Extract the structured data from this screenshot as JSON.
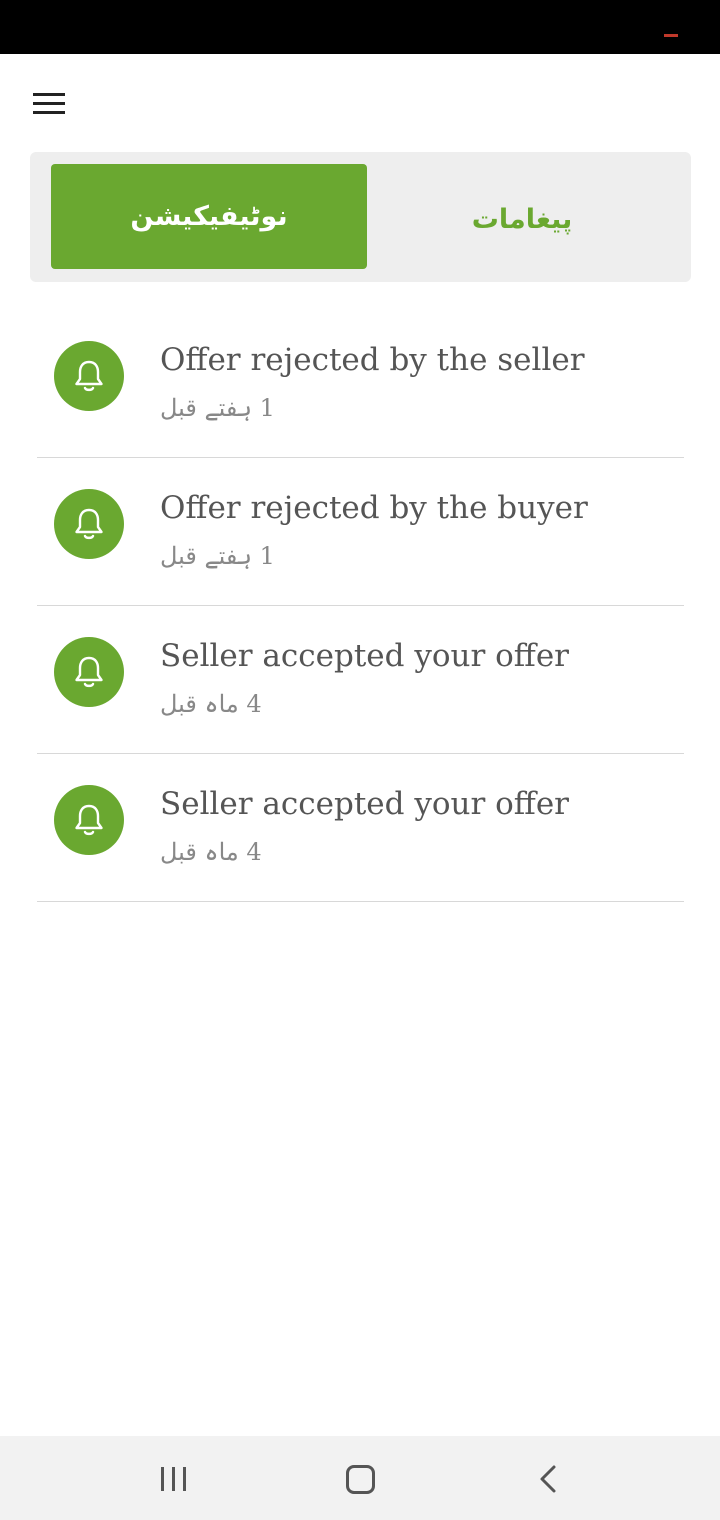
{
  "header": {
    "menu_icon": "hamburger-menu-icon"
  },
  "tabs": {
    "notifications_label": "نوٹیفیکیشن",
    "messages_label": "پیغامات",
    "active": "notifications"
  },
  "notifications": [
    {
      "icon": "bell-icon",
      "title": "Offer rejected by the seller",
      "time": "1 ہفتے قبل"
    },
    {
      "icon": "bell-icon",
      "title": "Offer rejected by the buyer",
      "time": "1 ہفتے قبل"
    },
    {
      "icon": "bell-icon",
      "title": "Seller accepted your offer",
      "time": "4 ماہ قبل"
    },
    {
      "icon": "bell-icon",
      "title": "Seller accepted your offer",
      "time": "4 ماہ قبل"
    }
  ],
  "system_nav": {
    "recent_icon": "recent-apps-icon",
    "home_icon": "home-icon",
    "back_icon": "back-icon"
  },
  "colors": {
    "accent": "#6aa830",
    "tab_background": "#eeeeee",
    "status_bar": "#000000",
    "nav_bar": "#f2f2f2"
  }
}
